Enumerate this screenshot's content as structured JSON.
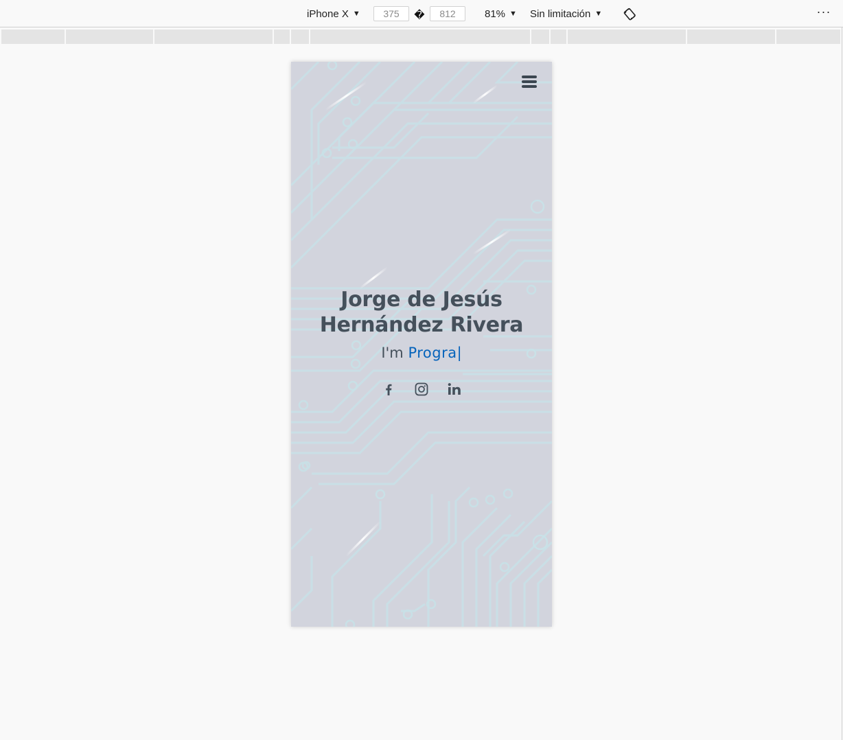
{
  "toolbar": {
    "device_label": "iPhone X",
    "width_value": "375",
    "separator": "�",
    "height_value": "812",
    "zoom_label": "81%",
    "throttle_label": "Sin limitación",
    "rotate_icon": "rotate-icon",
    "more_icon": "more-icon",
    "more_glyph": "···"
  },
  "page": {
    "menu_icon": "hamburger-icon",
    "hero": {
      "name": "Jorge de Jesús Hernández Rivera",
      "prefix": "I'm",
      "typed_text": "Progra",
      "cursor": "|"
    },
    "social": [
      {
        "name": "facebook",
        "icon": "facebook-icon"
      },
      {
        "name": "instagram",
        "icon": "instagram-icon"
      },
      {
        "name": "linkedin",
        "icon": "linkedin-icon"
      }
    ]
  },
  "colors": {
    "accent": "#0563bb",
    "heading": "#45505b",
    "background_tint": "#d2d4dd",
    "circuit_lines": "#c8e2e8"
  }
}
